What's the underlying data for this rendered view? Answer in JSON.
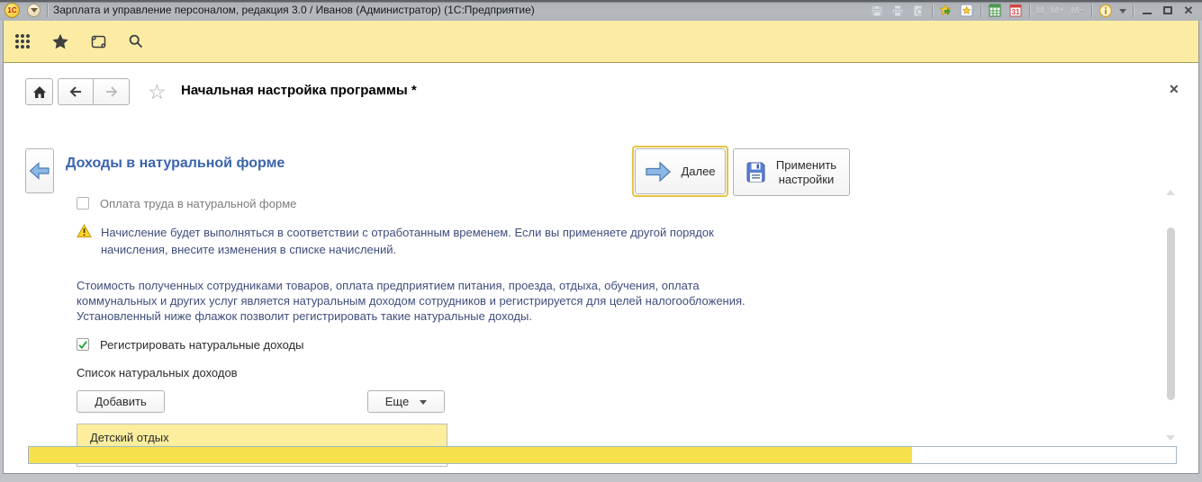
{
  "titlebar": {
    "logo_text": "1С",
    "title": "Зарплата и управление персоналом, редакция 3.0 / Иванов (Администратор)  (1С:Предприятие)",
    "calendar_day": "31",
    "memory": {
      "m": "M",
      "m_plus": "M+",
      "m_minus": "M−"
    },
    "window_controls": {
      "close_glyph": "✕"
    }
  },
  "toolbar_icons": [
    "menu-grid",
    "favorites-star",
    "history-scroll",
    "search-magnifier"
  ],
  "nav": {
    "title": "Начальная настройка программы *",
    "close_glyph": "✕",
    "favorite_star_glyph": "☆"
  },
  "form": {
    "heading": "Доходы в натуральной форме",
    "next_label": "Далее",
    "apply_label": "Применить настройки",
    "payment_checkbox": {
      "label": "Оплата труда в натуральной форме",
      "checked": false,
      "enabled": false
    },
    "warning_text": "Начисление будет выполняться в соответствии с отработанным временем. Если вы применяете другой порядок начисления, внесите изменения в списке начислений.",
    "description_text": "Стоимость полученных сотрудниками товаров, оплата предприятием питания, проезда, отдыха, обучения, оплата коммунальных и других услуг является натуральным доходом сотрудников и регистрируется для целей налогообложения. Установленный ниже флажок позволит регистрировать такие натуральные доходы.",
    "register_checkbox": {
      "label": "Регистрировать натуральные доходы",
      "checked": true
    },
    "list_label": "Список натуральных доходов",
    "add_button_label": "Добавить",
    "more_button_label": "Еще",
    "list_rows": [
      {
        "name": "Детский отдых",
        "selected": true
      }
    ],
    "progress_percent": 77
  },
  "colors": {
    "heading_blue": "#3a64ad",
    "body_text_blue": "#3f4e7d",
    "toolbar_yellow": "#fceca3",
    "selection_yellow": "#fdee9e",
    "progress_fill_yellow": "#f6e14b",
    "warning_yellow": "#ffd42a",
    "check_green": "#1fa335",
    "highlight_button_border": "#e7c43c"
  }
}
